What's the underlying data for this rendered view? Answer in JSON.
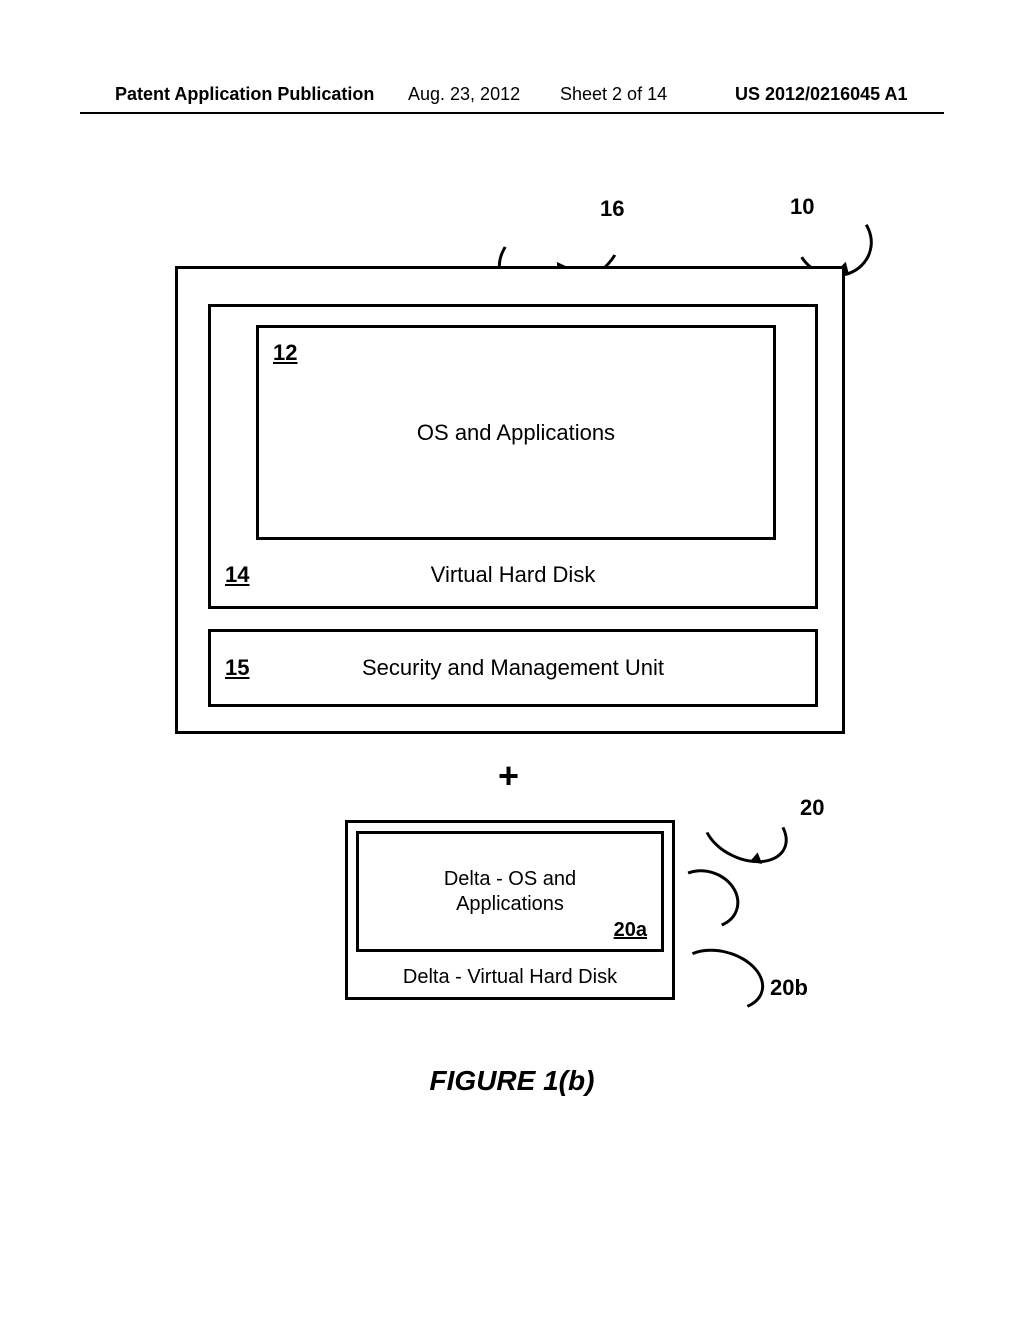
{
  "header": {
    "publication_label": "Patent Application Publication",
    "date": "Aug. 23, 2012",
    "sheet": "Sheet 2 of 14",
    "publication_number": "US 2012/0216045 A1"
  },
  "refs": {
    "r10": "10",
    "r16": "16",
    "r20": "20",
    "r20b": "20b"
  },
  "outer": {
    "vhd": {
      "ref": "14",
      "label": "Virtual Hard Disk"
    },
    "os": {
      "ref": "12",
      "label": "OS and Applications"
    },
    "sec": {
      "ref": "15",
      "label": "Security and Management Unit"
    }
  },
  "plus": "+",
  "delta": {
    "inner_label_line1": "Delta - OS and",
    "inner_label_line2": "Applications",
    "inner_ref": "20a",
    "outer_label": "Delta - Virtual Hard Disk"
  },
  "caption": "FIGURE 1(b)"
}
